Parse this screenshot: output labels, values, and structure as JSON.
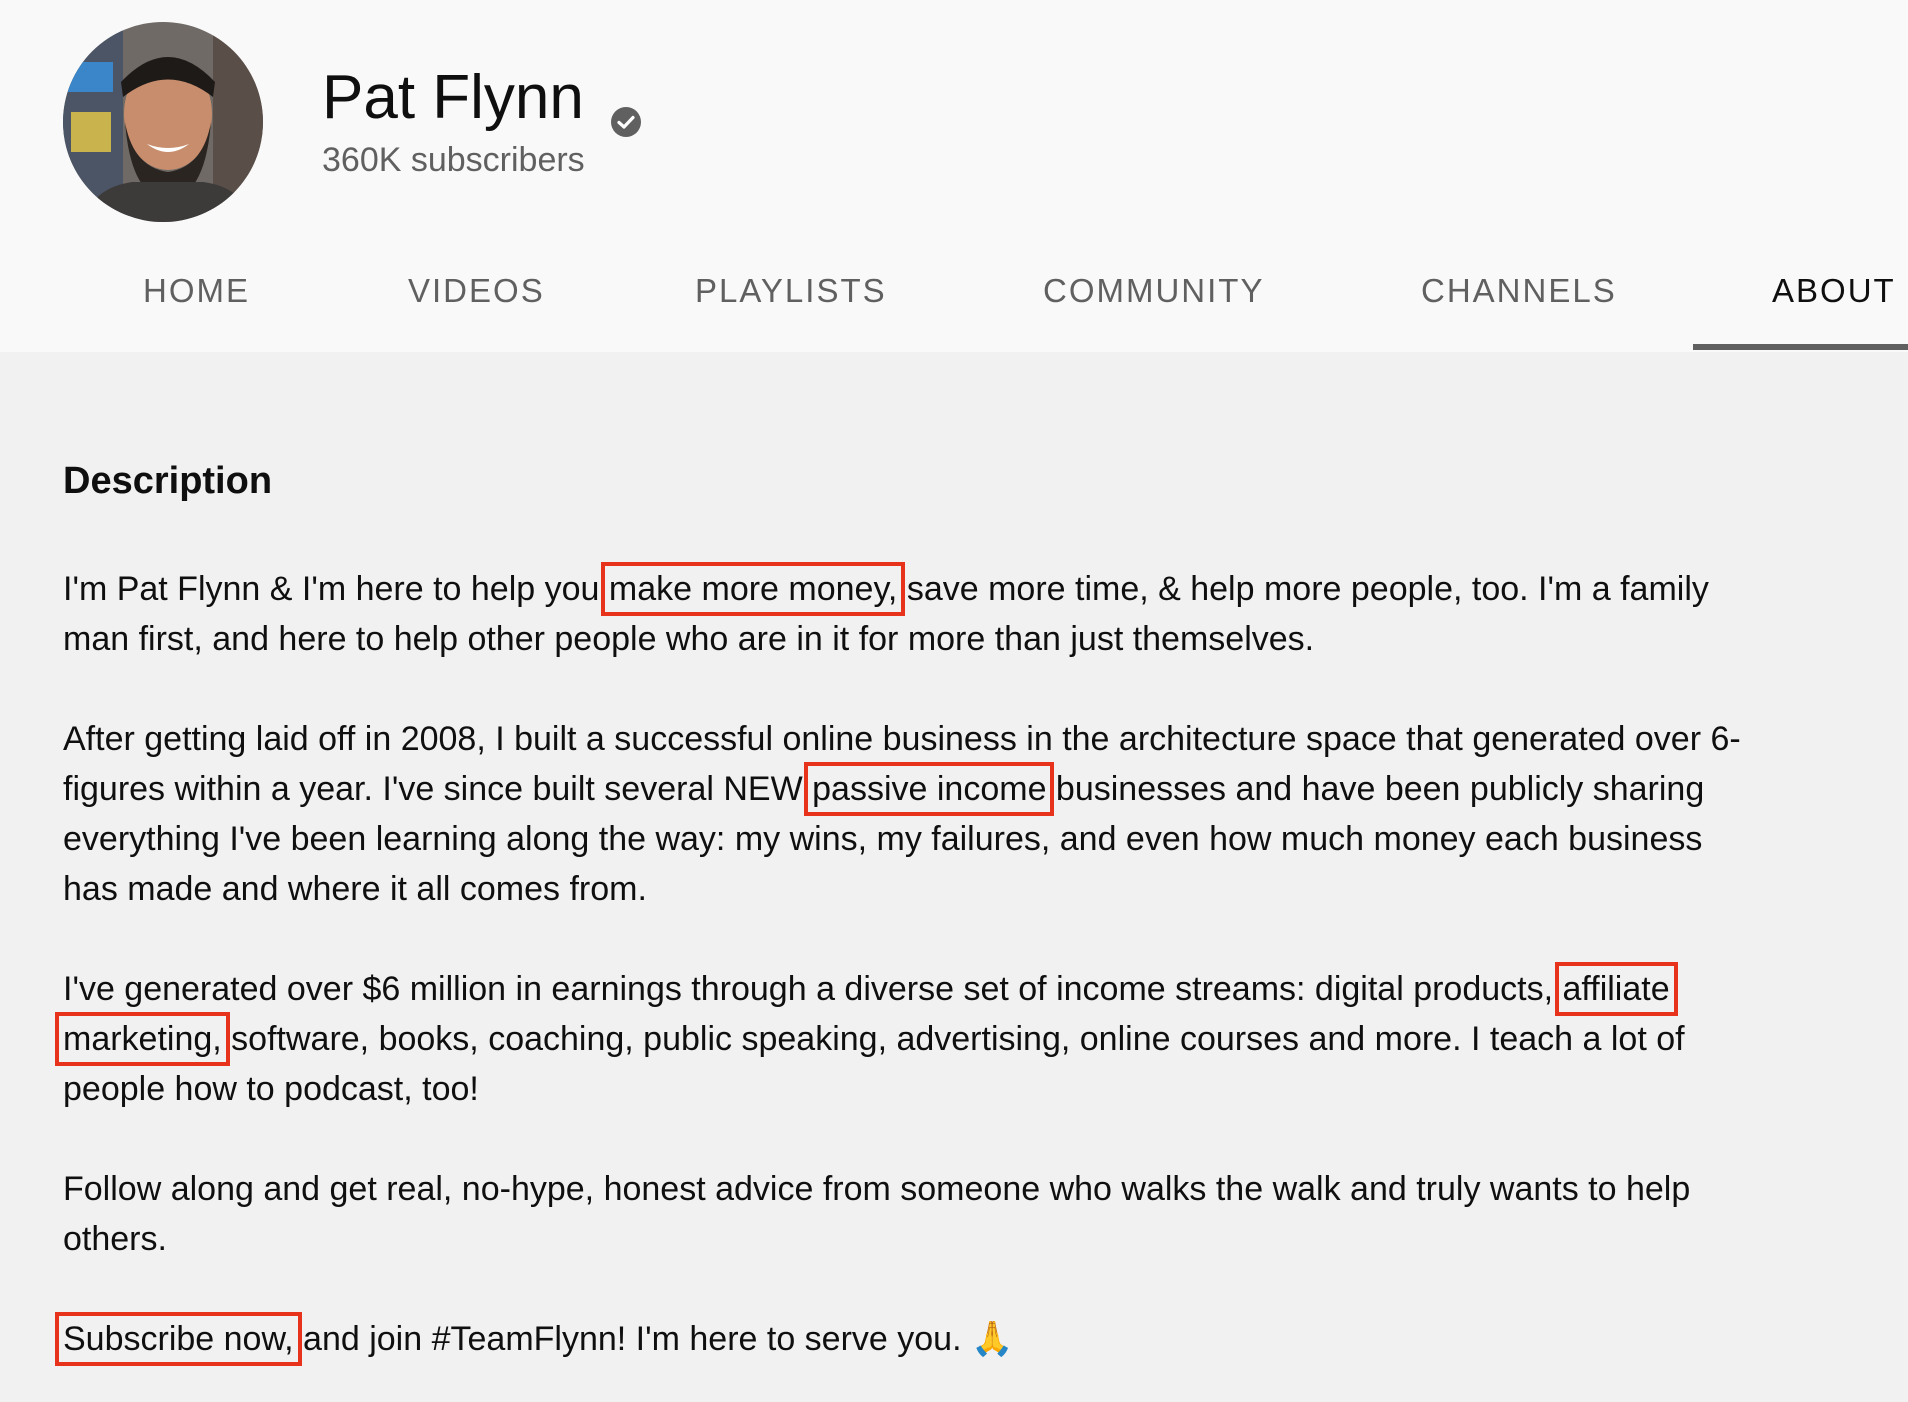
{
  "channel": {
    "name": "Pat Flynn",
    "subscribers": "360K subscribers",
    "verified_icon": "check-circle-icon"
  },
  "tabs": [
    {
      "label": "HOME",
      "active": false
    },
    {
      "label": "VIDEOS",
      "active": false
    },
    {
      "label": "PLAYLISTS",
      "active": false
    },
    {
      "label": "COMMUNITY",
      "active": false
    },
    {
      "label": "CHANNELS",
      "active": false
    },
    {
      "label": "ABOUT",
      "active": true
    }
  ],
  "about": {
    "description_title": "Description",
    "paragraphs": [
      {
        "before": "I'm Pat Flynn & I'm here to help you ",
        "highlight": "make more money,",
        "after": " save more time, & help more people, too. I'm a family man first, and here to help other people who are in it for more than just themselves."
      },
      {
        "before": "After getting laid off in 2008, I built a successful online business in the architecture space that generated over 6-figures within a year. I've since built several NEW ",
        "highlight": "passive income",
        "after": " businesses and have been publicly sharing everything I've been learning along the way: my wins, my failures, and even how much money each business has made and where it all comes from."
      },
      {
        "before": "I've generated over $6 million in earnings through a diverse set of income streams: digital products, ",
        "highlight": "affiliate marketing,",
        "after": " software, books, coaching, public speaking, advertising, online courses and more. I teach a lot of people how to podcast, too!"
      },
      {
        "before": "Follow along and get real, no-hype, honest advice from someone who walks the walk and truly wants to help others.",
        "highlight": "",
        "after": ""
      },
      {
        "before": "",
        "highlight": "Subscribe now,",
        "after": " and join #TeamFlynn! I'm here to serve you. 🙏"
      }
    ]
  },
  "colors": {
    "highlight_box": "#e8331c",
    "tab_underline": "#606060",
    "header_bg": "#f9f9f9",
    "page_bg": "#f1f1f1"
  }
}
